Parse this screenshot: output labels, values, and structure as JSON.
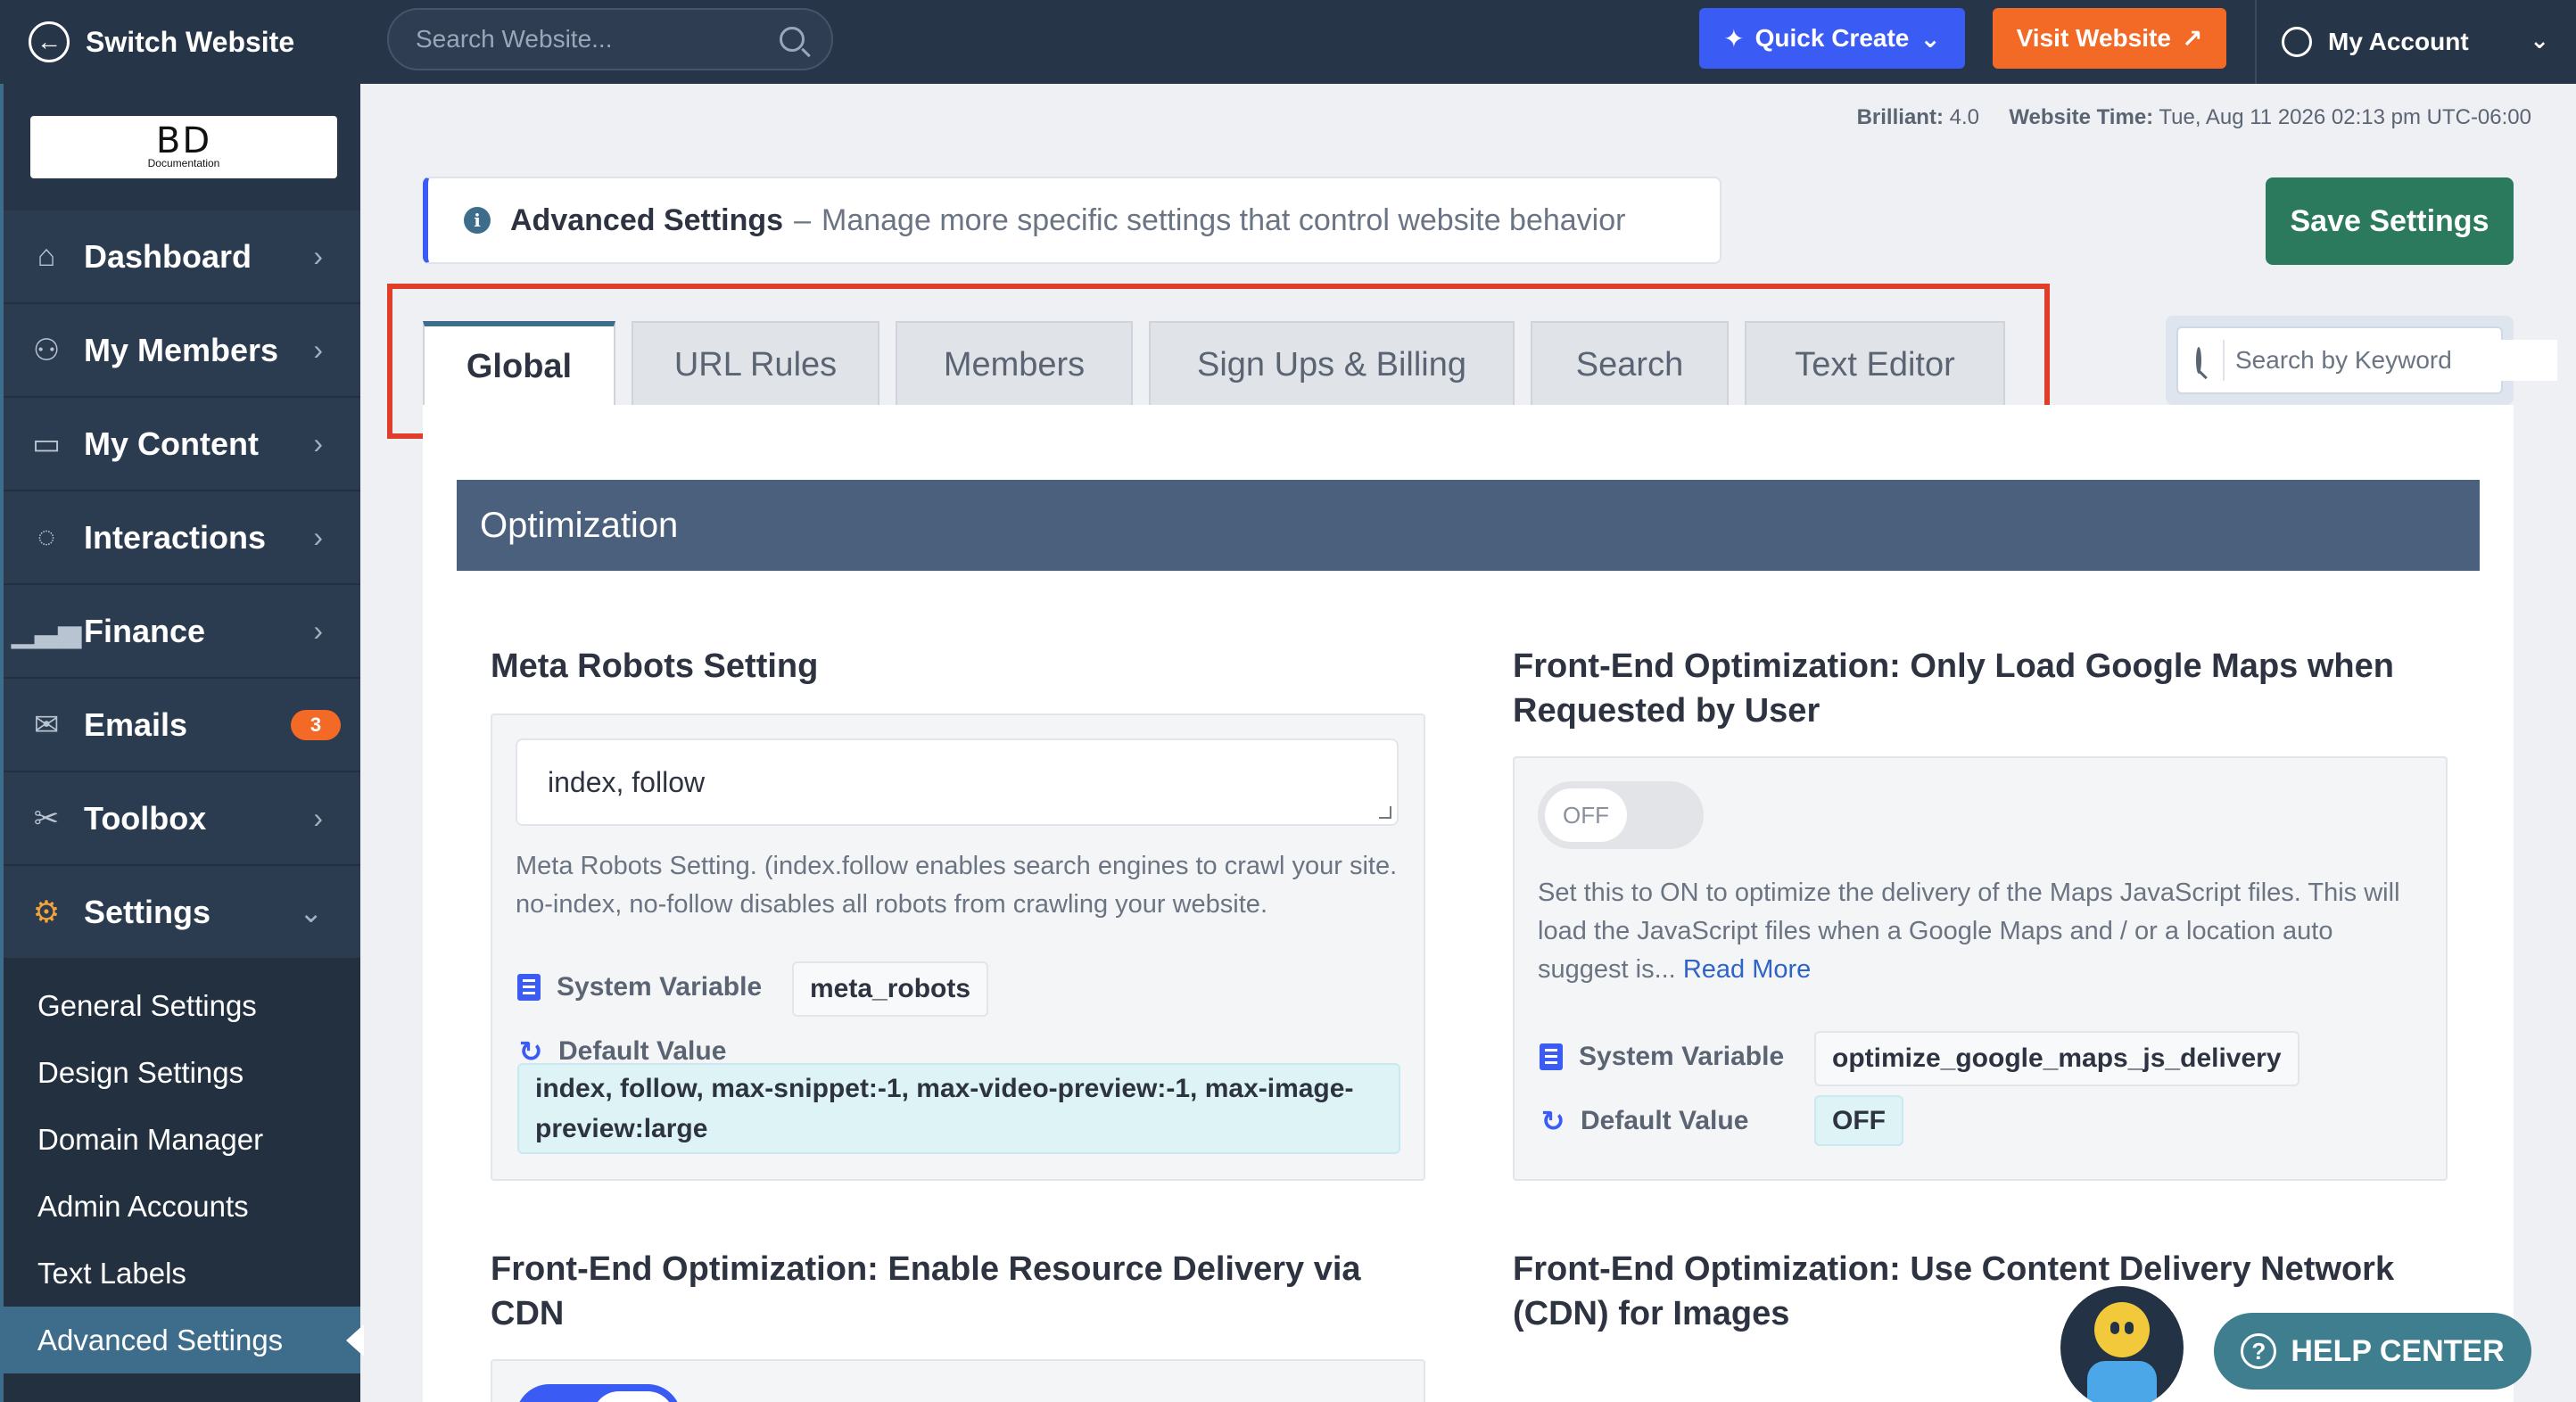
{
  "topbar": {
    "switch_label": "Switch Website",
    "search_placeholder": "Search Website...",
    "quick_create": "Quick Create",
    "visit_website": "Visit Website",
    "my_account": "My Account"
  },
  "logo": {
    "main": "BD",
    "sub": "Documentation"
  },
  "sidebar": {
    "items": [
      {
        "label": "Dashboard",
        "icon": "home-icon"
      },
      {
        "label": "My Members",
        "icon": "users-icon"
      },
      {
        "label": "My Content",
        "icon": "folder-icon"
      },
      {
        "label": "Interactions",
        "icon": "chat-icon"
      },
      {
        "label": "Finance",
        "icon": "bar-chart-icon"
      },
      {
        "label": "Emails",
        "icon": "envelope-icon",
        "badge": "3"
      },
      {
        "label": "Toolbox",
        "icon": "tools-icon"
      },
      {
        "label": "Settings",
        "icon": "gear-icon"
      }
    ],
    "sub_items": [
      "General Settings",
      "Design Settings",
      "Domain Manager",
      "Admin Accounts",
      "Text Labels",
      "Advanced Settings"
    ]
  },
  "info": {
    "brilliant_label": "Brilliant:",
    "brilliant_value": "4.0",
    "time_label": "Website Time:",
    "time_value": "Tue, Aug 11 2026 02:13 pm UTC-06:00"
  },
  "header": {
    "title": "Advanced Settings",
    "dash": "–",
    "description": "Manage more specific settings that control website behavior",
    "save_button": "Save Settings"
  },
  "tabs": [
    "Global",
    "URL Rules",
    "Members",
    "Sign Ups & Billing",
    "Search",
    "Text Editor"
  ],
  "keyword_search_placeholder": "Search by Keyword",
  "section": {
    "title": "Optimization",
    "settings": {
      "meta_robots": {
        "title": "Meta Robots Setting",
        "value": "index, follow",
        "help": "Meta Robots Setting. (index.follow enables search engines to crawl your site. no-index, no-follow disables all robots from crawling your website.",
        "system_variable_label": "System Variable",
        "system_variable": "meta_robots",
        "default_label": "Default Value",
        "default_value": "index, follow, max-snippet:-1, max-video-preview:-1, max-image-preview:large"
      },
      "google_maps": {
        "title": "Front-End Optimization: Only Load Google Maps when Requested by User",
        "toggle": "OFF",
        "help": "Set this to ON to optimize the delivery of the Maps JavaScript files. This will load the JavaScript files when a Google Maps and / or a location auto suggest is...",
        "read_more": "Read More",
        "system_variable_label": "System Variable",
        "system_variable": "optimize_google_maps_js_delivery",
        "default_label": "Default Value",
        "default_value": "OFF"
      },
      "cdn": {
        "title": "Front-End Optimization: Enable Resource Delivery via CDN"
      },
      "cdn_images": {
        "title": "Front-End Optimization: Use Content Delivery Network (CDN) for Images"
      }
    }
  },
  "help_center": "HELP CENTER",
  "colors": {
    "accent": "#3b5bf5",
    "sidebar": "#273548",
    "save": "#2c7a5e",
    "visit": "#f26a26",
    "highlight": "#e03d2b"
  }
}
